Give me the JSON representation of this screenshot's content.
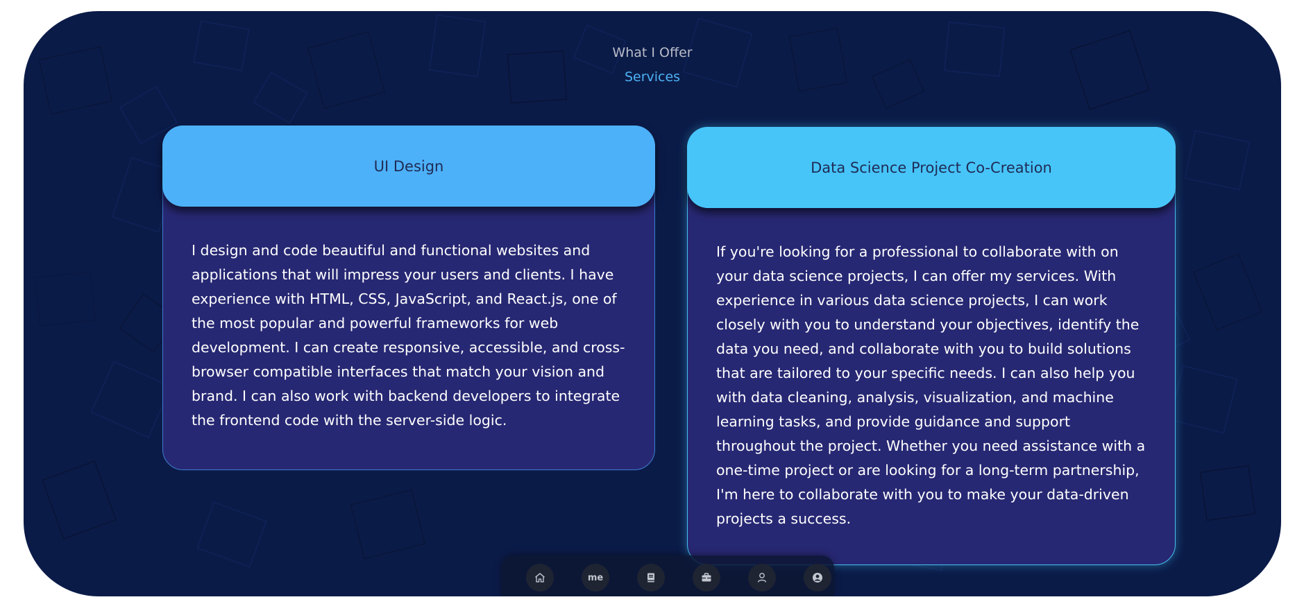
{
  "section": {
    "subtitle": "What I Offer",
    "title": "Services"
  },
  "services": [
    {
      "title": "UI Design",
      "description": "I design and code beautiful and functional websites and applications that will impress your users and clients. I have experience with HTML, CSS, JavaScript, and React.js, one of the most popular and powerful frameworks for web development. I can create responsive, accessible, and cross-browser compatible interfaces that match your vision and brand. I can also work with backend developers to integrate the frontend code with the server-side logic."
    },
    {
      "title": "Data Science Project Co-Creation",
      "description": "If you're looking for a professional to collaborate with on your data science projects, I can offer my services. With experience in various data science projects, I can work closely with you to understand your objectives, identify the data you need, and collaborate with you to build solutions that are tailored to your specific needs. I can also help you with data cleaning, analysis, visualization, and machine learning tasks, and provide guidance and support throughout the project. Whether you need assistance with a one-time project or are looking for a long-term partnership, I'm here to collaborate with you to make your data-driven projects a success."
    }
  ],
  "nav": {
    "items": [
      {
        "icon": "home-icon"
      },
      {
        "icon": "me-icon",
        "label": "me"
      },
      {
        "icon": "book-icon"
      },
      {
        "icon": "briefcase-icon"
      },
      {
        "icon": "user-icon"
      },
      {
        "icon": "account-circle-icon"
      }
    ]
  },
  "colors": {
    "background": "#0b1b48",
    "card_body": "#272873",
    "card_1_header": "#4db1f9",
    "card_2_header": "#47c5f9",
    "accent": "#4db3f5"
  }
}
